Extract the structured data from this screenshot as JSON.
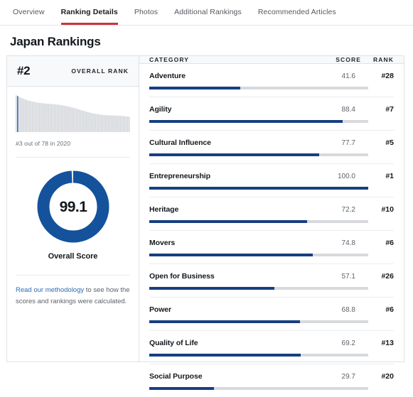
{
  "tabs": [
    {
      "label": "Overview",
      "active": false
    },
    {
      "label": "Ranking Details",
      "active": true
    },
    {
      "label": "Photos",
      "active": false
    },
    {
      "label": "Additional Rankings",
      "active": false
    },
    {
      "label": "Recommended Articles",
      "active": false
    }
  ],
  "page_title": "Japan Rankings",
  "overall": {
    "rank": "#2",
    "rank_caption": "OVERALL RANK",
    "sparkline_note": "#3 out of 78 in 2020",
    "score": "99.1",
    "score_label": "Overall Score",
    "highlight_index": 1,
    "total_bars": 78
  },
  "methodology": {
    "link_text": "Read our methodology",
    "rest_text": " to see how the scores and rankings were calculated."
  },
  "table": {
    "headers": {
      "category": "CATEGORY",
      "score": "SCORE",
      "rank": "RANK"
    },
    "rows": [
      {
        "category": "Adventure",
        "score": "41.6",
        "rank": "#28",
        "value": 41.6
      },
      {
        "category": "Agility",
        "score": "88.4",
        "rank": "#7",
        "value": 88.4
      },
      {
        "category": "Cultural Influence",
        "score": "77.7",
        "rank": "#5",
        "value": 77.7
      },
      {
        "category": "Entrepreneurship",
        "score": "100.0",
        "rank": "#1",
        "value": 100.0
      },
      {
        "category": "Heritage",
        "score": "72.2",
        "rank": "#10",
        "value": 72.2
      },
      {
        "category": "Movers",
        "score": "74.8",
        "rank": "#6",
        "value": 74.8
      },
      {
        "category": "Open for Business",
        "score": "57.1",
        "rank": "#26",
        "value": 57.1
      },
      {
        "category": "Power",
        "score": "68.8",
        "rank": "#6",
        "value": 68.8
      },
      {
        "category": "Quality of Life",
        "score": "69.2",
        "rank": "#13",
        "value": 69.2
      },
      {
        "category": "Social Purpose",
        "score": "29.7",
        "rank": "#20",
        "value": 29.7
      }
    ]
  },
  "chart_data": {
    "type": "bar",
    "title": "Japan Rankings",
    "xlabel": "",
    "ylabel": "Score",
    "ylim": [
      0,
      100
    ],
    "categories": [
      "Adventure",
      "Agility",
      "Cultural Influence",
      "Entrepreneurship",
      "Heritage",
      "Movers",
      "Open for Business",
      "Power",
      "Quality of Life",
      "Social Purpose"
    ],
    "values": [
      41.6,
      88.4,
      77.7,
      100.0,
      72.2,
      74.8,
      57.1,
      68.8,
      69.2,
      29.7
    ],
    "ranks": [
      28,
      7,
      5,
      1,
      10,
      6,
      26,
      6,
      13,
      20
    ],
    "overall_score": 99.1,
    "overall_rank": 2,
    "field_size": 78,
    "year": 2020,
    "grid": false,
    "legend": "none"
  },
  "colors": {
    "bar_fill": "#173f80",
    "bar_track": "#d7dadd",
    "donut": "#14529c",
    "tab_underline": "#cf3339",
    "link": "#2d6cb5"
  }
}
